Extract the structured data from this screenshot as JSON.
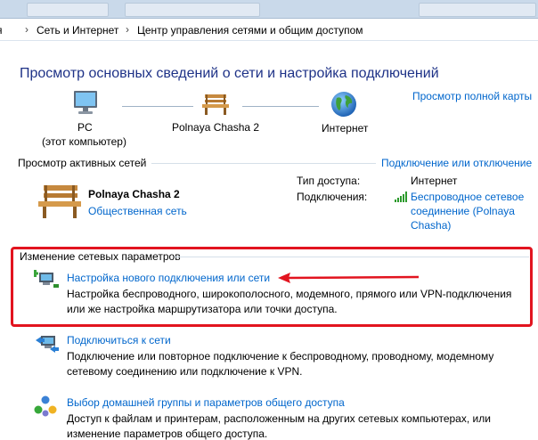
{
  "address_bar": {
    "crumbs": [
      "я",
      "Сеть и Интернет",
      "Центр управления сетями и общим доступом"
    ]
  },
  "header": {
    "title": "Просмотр основных сведений о сети и настройка подключений",
    "full_map_link": "Просмотр полной карты"
  },
  "network_map": {
    "pc_label": "PC",
    "pc_sublabel": "(этот компьютер)",
    "network_label": "Polnaya Chasha  2",
    "internet_label": "Интернет"
  },
  "active_networks": {
    "section_label": "Просмотр активных сетей",
    "connect_link": "Подключение или отключение",
    "network_name": "Polnaya Chasha  2",
    "network_type_link": "Общественная сеть",
    "access_type_label": "Тип доступа:",
    "access_type_value": "Интернет",
    "connections_label": "Подключения:",
    "connection_link_1": "Беспроводное сетевое",
    "connection_link_2": "соединение (Polnaya",
    "connection_link_3": "Chasha)"
  },
  "change_settings": {
    "section_label": "Изменение сетевых параметров",
    "items": [
      {
        "link": "Настройка нового подключения или сети",
        "desc_1": "Настройка беспроводного, широкополосного, модемного, прямого или VPN-подключения",
        "desc_2": "или же настройка маршрутизатора или точки доступа."
      },
      {
        "link": "Подключиться к сети",
        "desc_1": "Подключение или повторное подключение к беспроводному, проводному, модемному",
        "desc_2": "сетевому соединению или подключение к VPN."
      },
      {
        "link": "Выбор домашней группы и параметров общего доступа",
        "desc_1": "Доступ к файлам и принтерам, расположенным на других сетевых компьютерах, или",
        "desc_2": "изменение параметров общего доступа."
      }
    ]
  },
  "colors": {
    "title": "#1e3287",
    "link": "#0066cc",
    "highlight_box": "#e2141f"
  },
  "icons": [
    "computer-icon",
    "bench-icon",
    "globe-icon",
    "signal-bars-icon",
    "new-connection-icon",
    "connect-network-icon",
    "homegroup-icon"
  ]
}
